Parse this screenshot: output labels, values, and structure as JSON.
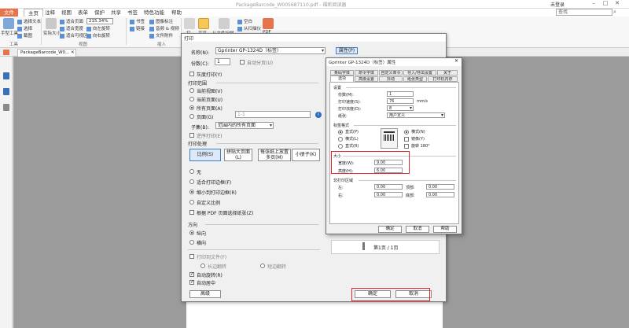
{
  "titlebar": {
    "doc_title": "PackageBarcode_W005687110.pdf - 福昕阅读器",
    "user_label": "未登录"
  },
  "menu": [
    "文件",
    "主页",
    "注释",
    "视图",
    "表单",
    "保护",
    "共享",
    "书签",
    "特色功能",
    "帮助"
  ],
  "search": {
    "placeholder": "查找"
  },
  "ribbon": {
    "hand_tool": "手型工具",
    "select_text": "选择文本",
    "select_annot": "选择",
    "snapshot": "截图",
    "actual_size": "实际大小",
    "fit_page": "适合页面",
    "fit_width": "适合宽度",
    "fit_visible": "适合可视区",
    "zoom": "215.34%",
    "rotate_left": "向左旋转",
    "rotate_right": "向右旋转",
    "bookmark": "书签",
    "link": "链接",
    "image_annot": "图像标注",
    "audio_video": "音频 & 视频",
    "file_attach": "文件附件",
    "typewriter": "打",
    "highlight": "高亮",
    "from_scanner": "从文件扫描",
    "blank": "空白",
    "from_scan": "从扫描仪",
    "pdf_label": "PDF",
    "group_tools": "工具",
    "group_view": "视图",
    "group_insert": "插入"
  },
  "doc_tab": "PackageBarcode_W0...",
  "print_dialog": {
    "title": "打印",
    "printer_label": "名称(N):",
    "printer_name": "Gprinter GP-1324D（标签）",
    "properties_btn": "属性(P)",
    "copies_label": "份数(C):",
    "copies_value": "1",
    "collate_label": "自动分页(U)",
    "gray_print": "灰度打印(Y)",
    "range_title": "打印范围",
    "range_current_view": "当前视图(V)",
    "range_current_page": "当前页面(U)",
    "range_all_pages": "所有页面(A)",
    "range_pages": "页面(G)",
    "pages_value": "1-1",
    "subset_label": "子集(B):",
    "subset_value": "范围内的所有页面",
    "reverse_label": "逆序打印(E)",
    "handling_title": "打印处理",
    "btn_scale": "比例(S)",
    "btn_tile_large": "拼贴大页面(L)",
    "btn_multi_per_sheet": "每张纸上放置多页(M)",
    "btn_booklet": "小册子(K)",
    "opt_none": "无",
    "opt_fit_printable": "适合打印边框(F)",
    "opt_shrink_printable": "缩小到打印边框(R)",
    "opt_custom_scale": "自定义比例",
    "opt_choose_paper": "根据 PDF 页面选择纸张(Z)",
    "orientation_title": "方向",
    "portrait": "纵向",
    "landscape": "横向",
    "print_to_file": "打印到文件(F)",
    "both_sides": "长边翻转",
    "short_side": "短边翻转",
    "auto_rotate": "自动旋转(R)",
    "auto_center": "自动居中",
    "advanced_btn": "高级",
    "ok_btn": "确定",
    "cancel_btn": "取消",
    "preview_pages": "第1页 / 1页"
  },
  "prop_dialog": {
    "title": "Gprinter GP-1324D（标签）属性",
    "tabs_row1": [
      "条码字体",
      "命令字体",
      "自定义命令",
      "导入/导出设置",
      "关于"
    ],
    "tabs_row2": [
      "选项",
      "高级设置",
      "抖动",
      "纸张类型",
      "打印机内存"
    ],
    "settings_title": "设置",
    "copies_label": "份数(M):",
    "copies_value": "1",
    "speed_label": "打印速度(S):",
    "speed_value": "76",
    "speed_unit": "mm/s",
    "darkness_label": "打印浓度(D):",
    "darkness_value": "8",
    "stock_label": "纸张:",
    "stock_value": "用户定义",
    "format_title": "标签格式",
    "fmt_portrait": "直式(P)",
    "fmt_landscape": "横式(L)",
    "fmt_portrait2": "直式(R)",
    "fmt_landscape2": "横式(N)",
    "fmt_mirror": "镜像(Y)",
    "fmt_rotate180": "旋转 180°",
    "size_title": "大小",
    "width_label": "宽度(W):",
    "width_value": "9.00",
    "height_label": "高度(H):",
    "height_value": "6.00",
    "margins_title": "非打印区域",
    "margin_left": "左:",
    "margin_left_v": "0.00",
    "margin_top": "顶部:",
    "margin_top_v": "0.00",
    "margin_right": "右:",
    "margin_right_v": "0.00",
    "margin_bottom": "底部:",
    "margin_bottom_v": "0.00",
    "ok_btn": "确定",
    "cancel_btn": "取消",
    "help_btn": "帮助"
  },
  "colors": {
    "accent": "#e7734b",
    "highlight": "#e0262b"
  }
}
